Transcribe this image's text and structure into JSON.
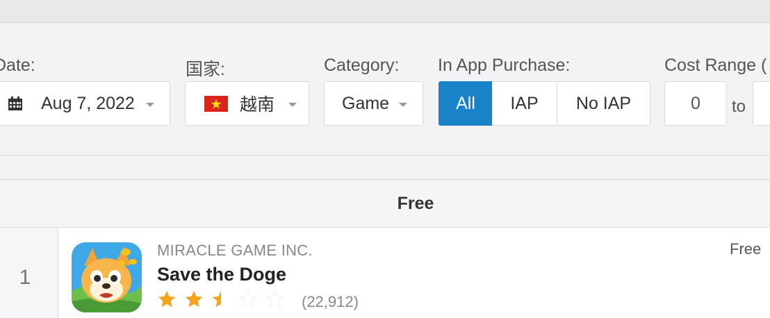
{
  "filters": {
    "date": {
      "label": "Date:",
      "value": "Aug 7, 2022"
    },
    "country": {
      "label": "国家:",
      "value": "越南",
      "flag": "vietnam-flag"
    },
    "category": {
      "label": "Category:",
      "value": "Game"
    },
    "iap": {
      "label": "In App Purchase:",
      "options": [
        "All",
        "IAP",
        "No IAP"
      ],
      "selected": "All"
    },
    "cost": {
      "label": "Cost Range (",
      "min": "0",
      "to": "to"
    }
  },
  "table": {
    "header": "Free",
    "rows": [
      {
        "rank": "1",
        "developer": "MIRACLE GAME INC.",
        "name": "Save the Doge",
        "rating": 2.5,
        "rating_max": 5,
        "ratings_count": "(22,912)",
        "price": "Free"
      }
    ]
  },
  "colors": {
    "accent": "#1a82c9",
    "star": "#f5a31a",
    "star_empty": "#ffffff"
  }
}
